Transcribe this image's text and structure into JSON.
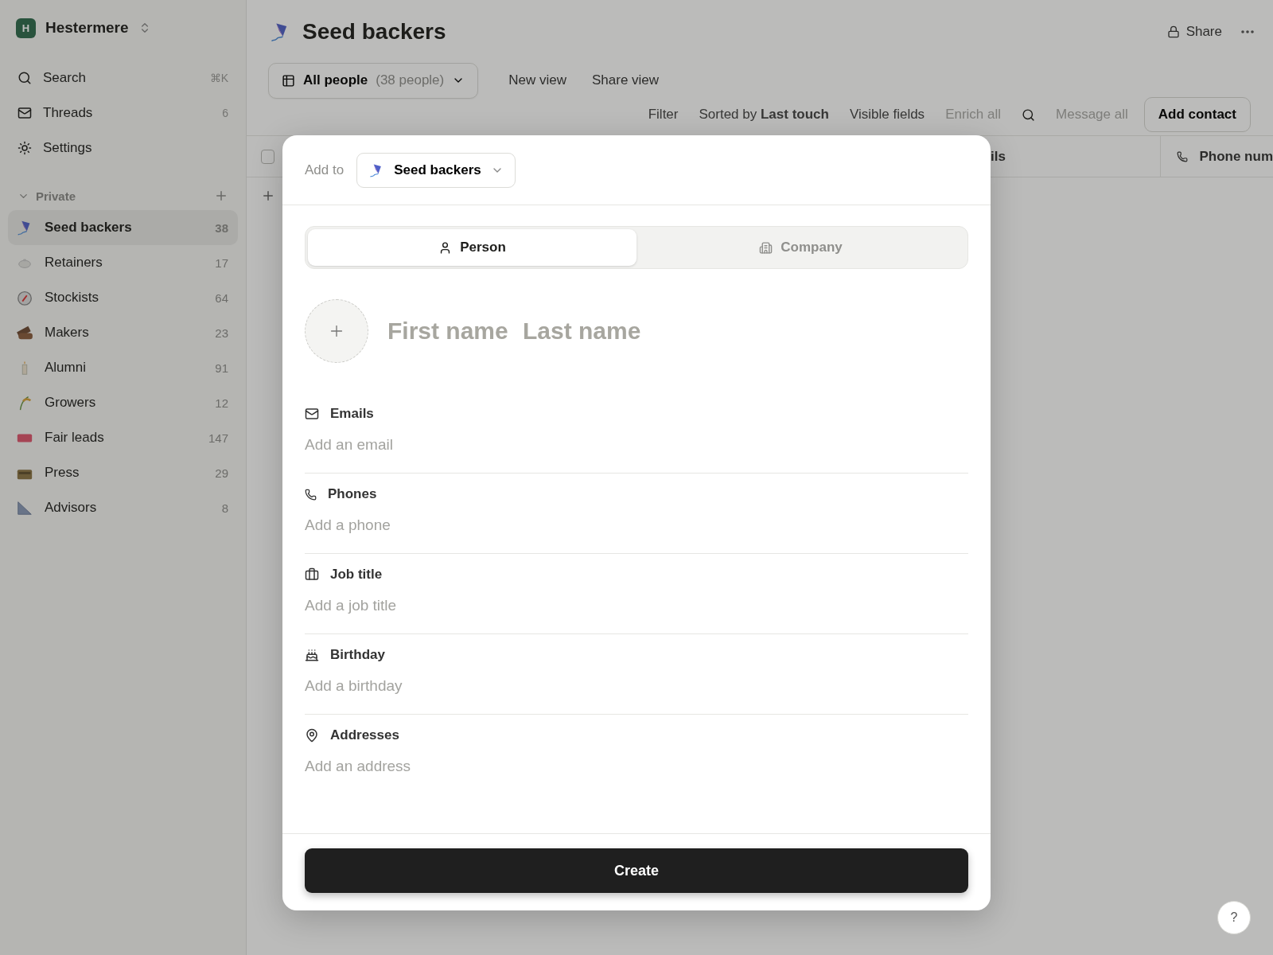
{
  "workspace": {
    "initial": "H",
    "name": "Hestermere"
  },
  "nav": [
    {
      "kind": "search",
      "label": "Search",
      "hint": "⌘K"
    },
    {
      "kind": "threads",
      "label": "Threads",
      "hint": "6"
    },
    {
      "kind": "settings",
      "label": "Settings"
    }
  ],
  "section": {
    "title": "Private",
    "expanded": true
  },
  "lists": [
    {
      "label": "Seed backers",
      "count": "38",
      "selected": true
    },
    {
      "label": "Retainers",
      "count": "17",
      "selected": false
    },
    {
      "label": "Stockists",
      "count": "64",
      "selected": false
    },
    {
      "label": "Makers",
      "count": "23",
      "selected": false
    },
    {
      "label": "Alumni",
      "count": "91",
      "selected": false
    },
    {
      "label": "Growers",
      "count": "12",
      "selected": false
    },
    {
      "label": "Fair leads",
      "count": "147",
      "selected": false
    },
    {
      "label": "Press",
      "count": "29",
      "selected": false
    },
    {
      "label": "Advisors",
      "count": "8",
      "selected": false
    }
  ],
  "page": {
    "title": "Seed backers",
    "share": "Share"
  },
  "view": {
    "name": "All people",
    "count": "(38 people)"
  },
  "view_actions": [
    "New view",
    "Share view"
  ],
  "toolbar": [
    {
      "label": "Filter",
      "disabled": false
    },
    {
      "label": "Sorted by **Last touch**",
      "disabled": false
    },
    {
      "label": "Visible fields",
      "disabled": false
    },
    {
      "label": "Enrich all",
      "disabled": true
    },
    {
      "label": "Message all",
      "disabled": true
    }
  ],
  "add_contact": "Add contact",
  "table": {
    "select_all": {
      "checked": false
    },
    "columns": [
      {
        "label": "ils",
        "icon": false
      },
      {
        "label": "Phone num",
        "icon": true
      }
    ]
  },
  "modal": {
    "add_to": "Add to",
    "list": "Seed backers",
    "tabs": [
      {
        "kind": "person",
        "label": "Person",
        "selected": true
      },
      {
        "kind": "company",
        "label": "Company",
        "selected": false
      }
    ],
    "first_name": {
      "placeholder": "First name"
    },
    "last_name": {
      "placeholder": "Last name"
    },
    "fields": [
      {
        "kind": "email",
        "label": "Emails",
        "placeholder": "Add an email"
      },
      {
        "kind": "phone",
        "label": "Phones",
        "placeholder": "Add a phone"
      },
      {
        "kind": "job",
        "label": "Job title",
        "placeholder": "Add a job title"
      },
      {
        "kind": "birthday",
        "label": "Birthday",
        "placeholder": "Add a birthday"
      },
      {
        "kind": "address",
        "label": "Addresses",
        "placeholder": "Add an address"
      }
    ],
    "create": "Create"
  },
  "help": "?"
}
